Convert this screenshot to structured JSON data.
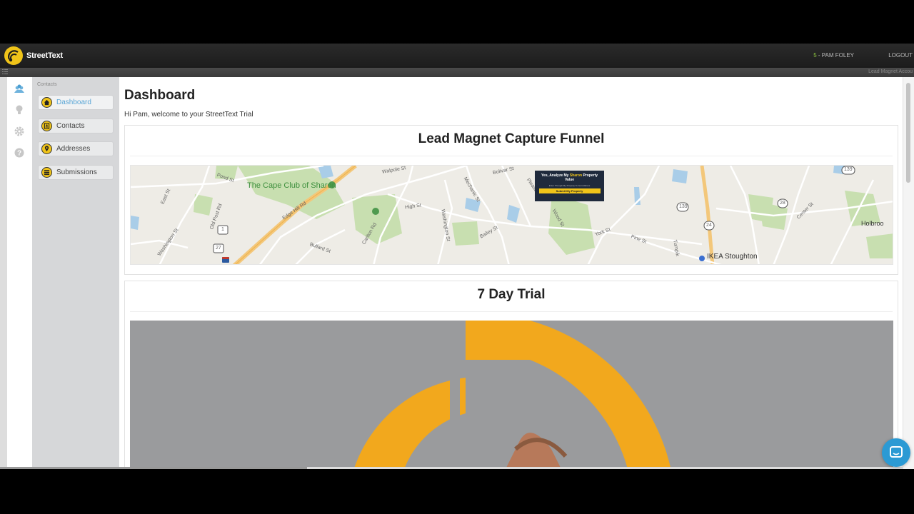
{
  "header": {
    "brand_name": "StreetText",
    "user_count": "5",
    "user_separator": " - ",
    "user_name": "PAM FOLEY",
    "logout_label": "LOGOUT",
    "account_label": "Lead Magnet Accou"
  },
  "sidebar": {
    "heading": "Contacts",
    "items": [
      {
        "label": "Dashboard",
        "icon": "home-icon",
        "active": true
      },
      {
        "label": "Contacts",
        "icon": "contacts-icon",
        "active": false
      },
      {
        "label": "Addresses",
        "icon": "map-pin-icon",
        "active": false
      },
      {
        "label": "Submissions",
        "icon": "submissions-icon",
        "active": false
      }
    ],
    "rail_icons": [
      "users-icon",
      "lightbulb-icon",
      "gear-icon",
      "help-icon"
    ]
  },
  "main": {
    "title": "Dashboard",
    "welcome": "Hi Pam, welcome to your StreetText Trial",
    "funnel_panel": {
      "title": "Lead Magnet Capture Funnel",
      "map_labels": {
        "park": "The Cape Club of Sharon",
        "poi": "IKEA Stoughton",
        "walpole": "Walpole St",
        "bolivar": "Bolivar St",
        "high": "High St",
        "washington": "Washington St",
        "mechanic": "Mechanic St",
        "pleasant": "Pleasant St",
        "edge_hill": "Edge Hill Rd",
        "old_post": "Old Post Rd",
        "carlton": "Carlton Rd",
        "bailey": "Bailey St",
        "pine": "Pine St",
        "york": "York St",
        "holbrook": "Holbroo",
        "center": "Center St",
        "turnpike": "Turnpik",
        "east": "East St",
        "west_washington": "Washington St",
        "pond": "Pond St",
        "wood": "Wood St",
        "bullard": "Bullard St",
        "r1": "1",
        "r27": "27",
        "r139a": "139",
        "r139b": "139",
        "r24": "24",
        "r28": "28"
      },
      "popup": {
        "title_before": "Yes, Analyze My ",
        "title_highlight": "Sharon",
        "title_after": " Property Value",
        "hint": "Enter Through My Property To Get Address",
        "button": "Submit My Property"
      }
    },
    "trial_panel": {
      "title": "7 Day Trial"
    }
  },
  "colors": {
    "brand_yellow": "#f0c419",
    "active_link": "#5aa6d6",
    "topbar": "#1c1c1c",
    "chat_button": "#2b9ad4"
  },
  "chat_widget": {
    "icon": "chat-icon"
  }
}
